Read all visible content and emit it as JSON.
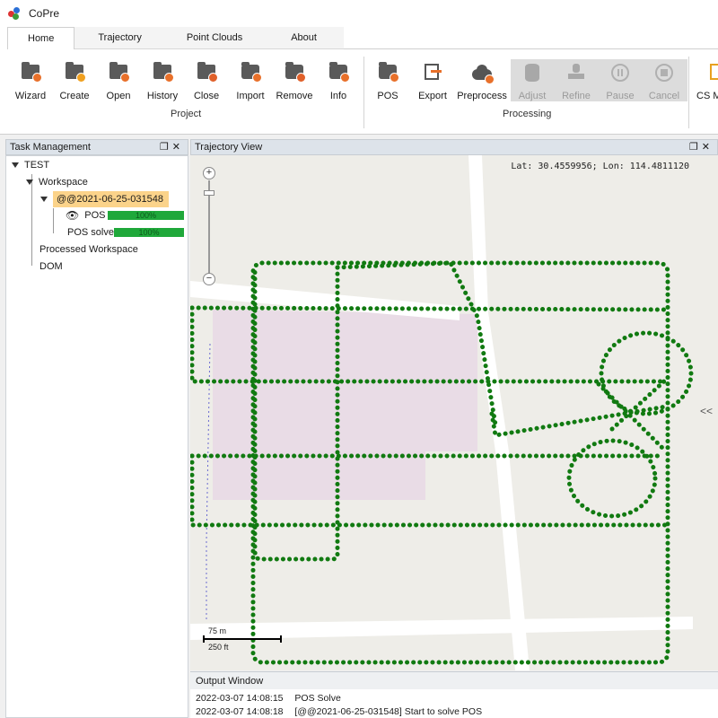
{
  "app": {
    "title": "CoPre"
  },
  "tabs": [
    {
      "label": "Home",
      "active": true
    },
    {
      "label": "Trajectory",
      "active": false
    },
    {
      "label": "Point Clouds",
      "active": false
    },
    {
      "label": "About",
      "active": false
    }
  ],
  "ribbon": {
    "project": {
      "label": "Project",
      "buttons": [
        {
          "label": "Wizard",
          "icon": "wizard-folder-icon"
        },
        {
          "label": "Create",
          "icon": "create-folder-icon"
        },
        {
          "label": "Open",
          "icon": "open-folder-icon"
        },
        {
          "label": "History",
          "icon": "history-folder-icon"
        },
        {
          "label": "Close",
          "icon": "close-folder-icon"
        },
        {
          "label": "Import",
          "icon": "import-box-icon"
        },
        {
          "label": "Remove",
          "icon": "remove-box-icon"
        },
        {
          "label": "Info",
          "icon": "info-box-icon"
        }
      ]
    },
    "processing": {
      "label": "Processing",
      "buttons": [
        {
          "label": "POS",
          "icon": "pos-box-icon",
          "enabled": true
        },
        {
          "label": "Export",
          "icon": "export-icon",
          "enabled": true
        },
        {
          "label": "Preprocess",
          "icon": "preprocess-cloud-icon",
          "enabled": true
        },
        {
          "label": "Adjust",
          "icon": "adjust-database-icon",
          "enabled": false
        },
        {
          "label": "Refine",
          "icon": "refine-stamp-icon",
          "enabled": false
        },
        {
          "label": "Pause",
          "icon": "pause-icon",
          "enabled": false
        },
        {
          "label": "Cancel",
          "icon": "cancel-icon",
          "enabled": false
        }
      ]
    },
    "cs": {
      "label": "CS M"
    }
  },
  "task_panel": {
    "title": "Task Management",
    "tree": {
      "root": "TEST",
      "workspace": "Workspace",
      "project": "@@2021-06-25-031548",
      "pos": {
        "label": "POS",
        "progress_text": "100%",
        "progress": 1.0
      },
      "pos_solve": {
        "label": "POS solve",
        "progress_text": "100%",
        "progress": 1.0
      },
      "processed": "Processed Workspace",
      "dom": "DOM"
    }
  },
  "map_panel": {
    "title": "Trajectory View",
    "coord_text": "Lat: 30.4559956; Lon: 114.4811120",
    "zoom_in": "+",
    "zoom_out": "−",
    "expand": "<<",
    "scale_m": "75 m",
    "scale_ft": "250 ft",
    "trajectory_color": "#117a11"
  },
  "output": {
    "title": "Output Window",
    "lines": [
      {
        "time": "2022-03-07 14:08:15",
        "message": "POS Solve"
      },
      {
        "time": "2022-03-07 14:08:18",
        "message": "[@@2021-06-25-031548] Start to solve POS"
      }
    ]
  }
}
